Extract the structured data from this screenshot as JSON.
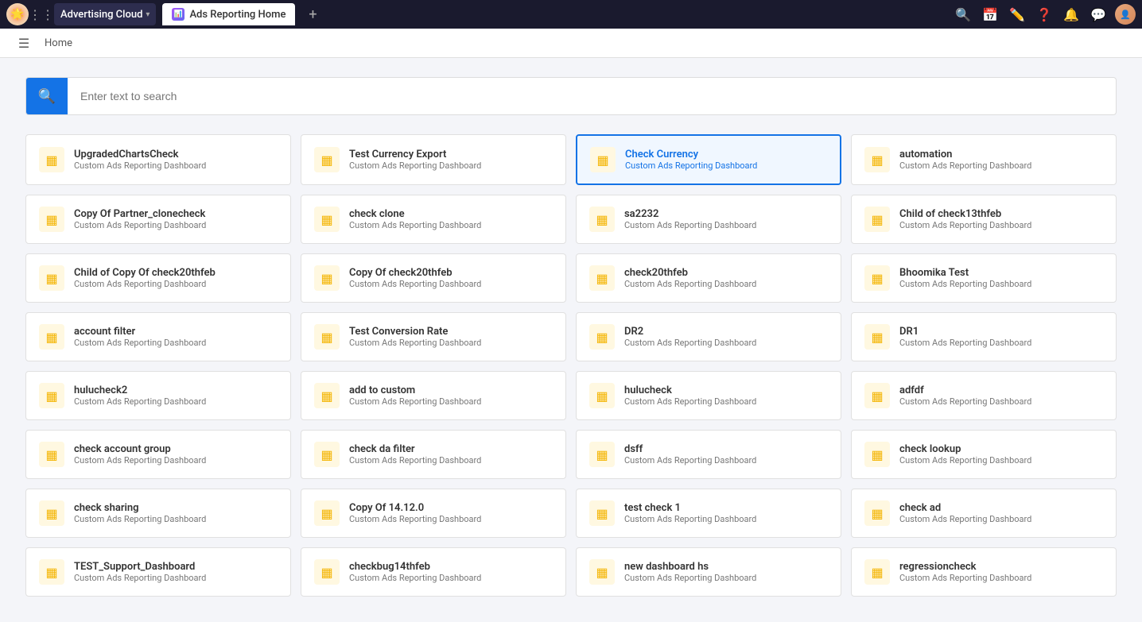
{
  "topnav": {
    "brand": "Advertising Cloud",
    "tab_label": "Ads Reporting Home",
    "tab_icon": "📊"
  },
  "breadcrumb": {
    "home_label": "Home"
  },
  "search": {
    "placeholder": "Enter text to search"
  },
  "cards": [
    {
      "id": 1,
      "title": "UpgradedChartsCheck",
      "subtitle": "Custom Ads Reporting Dashboard",
      "selected": false
    },
    {
      "id": 2,
      "title": "Test Currency Export",
      "subtitle": "Custom Ads Reporting Dashboard",
      "selected": false
    },
    {
      "id": 3,
      "title": "Check Currency",
      "subtitle": "Custom Ads Reporting Dashboard",
      "selected": true
    },
    {
      "id": 4,
      "title": "automation",
      "subtitle": "Custom Ads Reporting Dashboard",
      "selected": false
    },
    {
      "id": 5,
      "title": "Copy Of Partner_clonecheck",
      "subtitle": "Custom Ads Reporting Dashboard",
      "selected": false
    },
    {
      "id": 6,
      "title": "check clone",
      "subtitle": "Custom Ads Reporting Dashboard",
      "selected": false
    },
    {
      "id": 7,
      "title": "sa2232",
      "subtitle": "Custom Ads Reporting Dashboard",
      "selected": false
    },
    {
      "id": 8,
      "title": "Child of check13thfeb",
      "subtitle": "Custom Ads Reporting Dashboard",
      "selected": false
    },
    {
      "id": 9,
      "title": "Child of Copy Of check20thfeb",
      "subtitle": "Custom Ads Reporting Dashboard",
      "selected": false
    },
    {
      "id": 10,
      "title": "Copy Of check20thfeb",
      "subtitle": "Custom Ads Reporting Dashboard",
      "selected": false
    },
    {
      "id": 11,
      "title": "check20thfeb",
      "subtitle": "Custom Ads Reporting Dashboard",
      "selected": false
    },
    {
      "id": 12,
      "title": "Bhoomika Test",
      "subtitle": "Custom Ads Reporting Dashboard",
      "selected": false
    },
    {
      "id": 13,
      "title": "account filter",
      "subtitle": "Custom Ads Reporting Dashboard",
      "selected": false
    },
    {
      "id": 14,
      "title": "Test Conversion Rate",
      "subtitle": "Custom Ads Reporting Dashboard",
      "selected": false
    },
    {
      "id": 15,
      "title": "DR2",
      "subtitle": "Custom Ads Reporting Dashboard",
      "selected": false
    },
    {
      "id": 16,
      "title": "DR1",
      "subtitle": "Custom Ads Reporting Dashboard",
      "selected": false
    },
    {
      "id": 17,
      "title": "hulucheck2",
      "subtitle": "Custom Ads Reporting Dashboard",
      "selected": false
    },
    {
      "id": 18,
      "title": "add to custom",
      "subtitle": "Custom Ads Reporting Dashboard",
      "selected": false
    },
    {
      "id": 19,
      "title": "hulucheck",
      "subtitle": "Custom Ads Reporting Dashboard",
      "selected": false
    },
    {
      "id": 20,
      "title": "adfdf",
      "subtitle": "Custom Ads Reporting Dashboard",
      "selected": false
    },
    {
      "id": 21,
      "title": "check account group",
      "subtitle": "Custom Ads Reporting Dashboard",
      "selected": false
    },
    {
      "id": 22,
      "title": "check da filter",
      "subtitle": "Custom Ads Reporting Dashboard",
      "selected": false
    },
    {
      "id": 23,
      "title": "dsff",
      "subtitle": "Custom Ads Reporting Dashboard",
      "selected": false
    },
    {
      "id": 24,
      "title": "check lookup",
      "subtitle": "Custom Ads Reporting Dashboard",
      "selected": false
    },
    {
      "id": 25,
      "title": "check sharing",
      "subtitle": "Custom Ads Reporting Dashboard",
      "selected": false
    },
    {
      "id": 26,
      "title": "Copy Of 14.12.0",
      "subtitle": "Custom Ads Reporting Dashboard",
      "selected": false
    },
    {
      "id": 27,
      "title": "test check 1",
      "subtitle": "Custom Ads Reporting Dashboard",
      "selected": false
    },
    {
      "id": 28,
      "title": "check ad",
      "subtitle": "Custom Ads Reporting Dashboard",
      "selected": false
    },
    {
      "id": 29,
      "title": "TEST_Support_Dashboard",
      "subtitle": "Custom Ads Reporting Dashboard",
      "selected": false
    },
    {
      "id": 30,
      "title": "checkbug14thfeb",
      "subtitle": "Custom Ads Reporting Dashboard",
      "selected": false
    },
    {
      "id": 31,
      "title": "new dashboard hs",
      "subtitle": "Custom Ads Reporting Dashboard",
      "selected": false
    },
    {
      "id": 32,
      "title": "regressioncheck",
      "subtitle": "Custom Ads Reporting Dashboard",
      "selected": false
    }
  ]
}
